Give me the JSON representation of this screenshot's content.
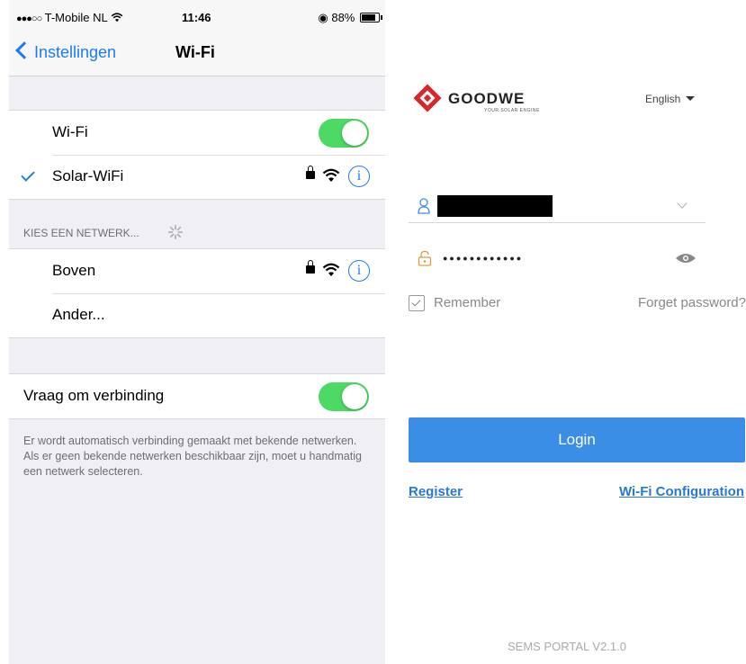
{
  "ios": {
    "status": {
      "signal_dots": "●●●○○",
      "carrier": "T-Mobile NL",
      "time": "11:46",
      "battery": "88%"
    },
    "nav": {
      "back_label": "Instellingen",
      "title": "Wi-Fi"
    },
    "wifi_group": {
      "wifi_label": "Wi-Fi",
      "wifi_on": true,
      "connected_network": "Solar-WiFi"
    },
    "choose_network_header": "KIES EEN NETWERK...",
    "networks": [
      {
        "name": "Boven",
        "locked": true
      },
      {
        "name": "Ander...",
        "locked": false
      }
    ],
    "ask_join": {
      "label": "Vraag om verbinding",
      "on": true
    },
    "footnote": "Er wordt automatisch verbinding gemaakt met bekende netwerken. Als er geen bekende netwerken beschikbaar zijn, moet u handmatig een netwerk selecteren.",
    "info_glyph": "i",
    "colors": {
      "accent": "#1d7bf2",
      "toggle_on": "#4cd964"
    }
  },
  "goodwe": {
    "logo_text": "GOODWE",
    "logo_tagline": "YOUR SOLAR ENGINE",
    "language": "English",
    "password_mask": "●●●●●●●●●●●●",
    "remember_label": "Remember",
    "remember_checked": true,
    "forget_password": "Forget password?",
    "login_label": "Login",
    "register_label": "Register",
    "wifi_config_label": "Wi-Fi Configuration",
    "version": "SEMS PORTAL V2.1.0",
    "colors": {
      "primary": "#3a8ee6",
      "logo_red": "#d9262b"
    }
  }
}
